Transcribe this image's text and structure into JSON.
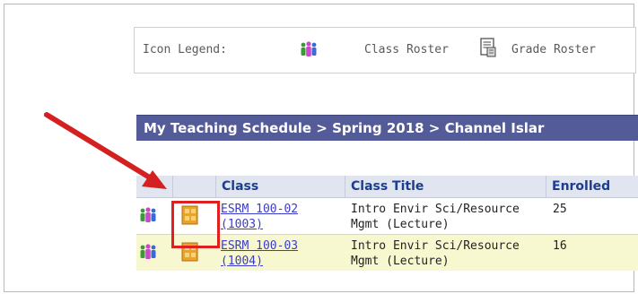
{
  "legend": {
    "label": "Icon Legend:",
    "class_roster": "Class Roster",
    "grade_roster": "Grade Roster"
  },
  "banner": {
    "text": "My Teaching Schedule > Spring 2018 > Channel Islar"
  },
  "table": {
    "headers": [
      "Class",
      "Class Title",
      "Enrolled"
    ],
    "rows": [
      {
        "class_line1": "ESRM 100-02",
        "class_line2": "(1003)",
        "title_line1": "Intro Envir Sci/Resource",
        "title_line2": "Mgmt (Lecture)",
        "enrolled": "25"
      },
      {
        "class_line1": "ESRM 100-03",
        "class_line2": "(1004)",
        "title_line1": "Intro Envir Sci/Resource",
        "title_line2": "Mgmt (Lecture)",
        "enrolled": "16"
      }
    ]
  },
  "colors": {
    "banner": "#535c98",
    "header": "#e0e5ef",
    "alt_row": "#f8f8d0",
    "highlight": "#e02020",
    "link": "#3b3bcc"
  },
  "icons": {
    "class_roster": "people-icon",
    "grade_roster": "grade-roster-icon",
    "annotation": "red-arrow-icon"
  }
}
